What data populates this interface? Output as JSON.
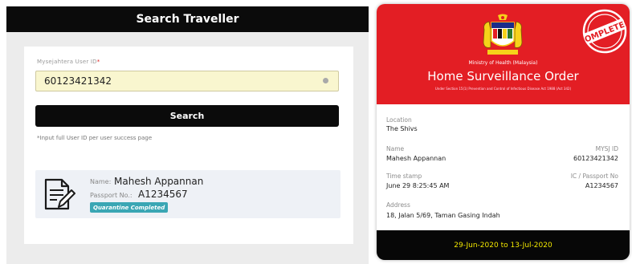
{
  "search_panel": {
    "header_title": "Search Traveller",
    "field_label": "Mysejahtera User ID",
    "required_mark": "*",
    "field_value": "60123421342",
    "search_button": "Search",
    "hint": "*Input full User ID per user success page"
  },
  "result": {
    "name_label": "Name:",
    "name_value": "Mahesh Appannan",
    "passport_label": "Passport No.:",
    "passport_value": "A1234567",
    "status": "Quarantine Completed",
    "icon": "document-edit-icon"
  },
  "order_card": {
    "ministry": "Ministry of Health (Malaysia)",
    "title": "Home Surveillance Order",
    "subtitle": "Under Section 15(1) Prevention and Control of Infectious Disease Act 1988 (Act 342)",
    "stamp_text": "COMPLETED",
    "location_label": "Location",
    "location_value": "The Shivs",
    "name_label": "Name",
    "name_value": "Mahesh Appannan",
    "mysj_label": "MYSJ ID",
    "mysj_value": "60123421342",
    "timestamp_label": "Time stamp",
    "timestamp_value": "June 29 8:25:45 AM",
    "ic_label": "IC / Passport No",
    "ic_value": "A1234567",
    "address_label": "Address",
    "address_value": "18, Jalan 5/69, Taman Gasing Indah",
    "date_range": "29-Jun-2020 to 13-Jul-2020"
  },
  "colors": {
    "card_red": "#e31e24",
    "footer_text": "#f2e700",
    "badge": "#3aa6b4",
    "input_bg": "#f9f6cf"
  }
}
